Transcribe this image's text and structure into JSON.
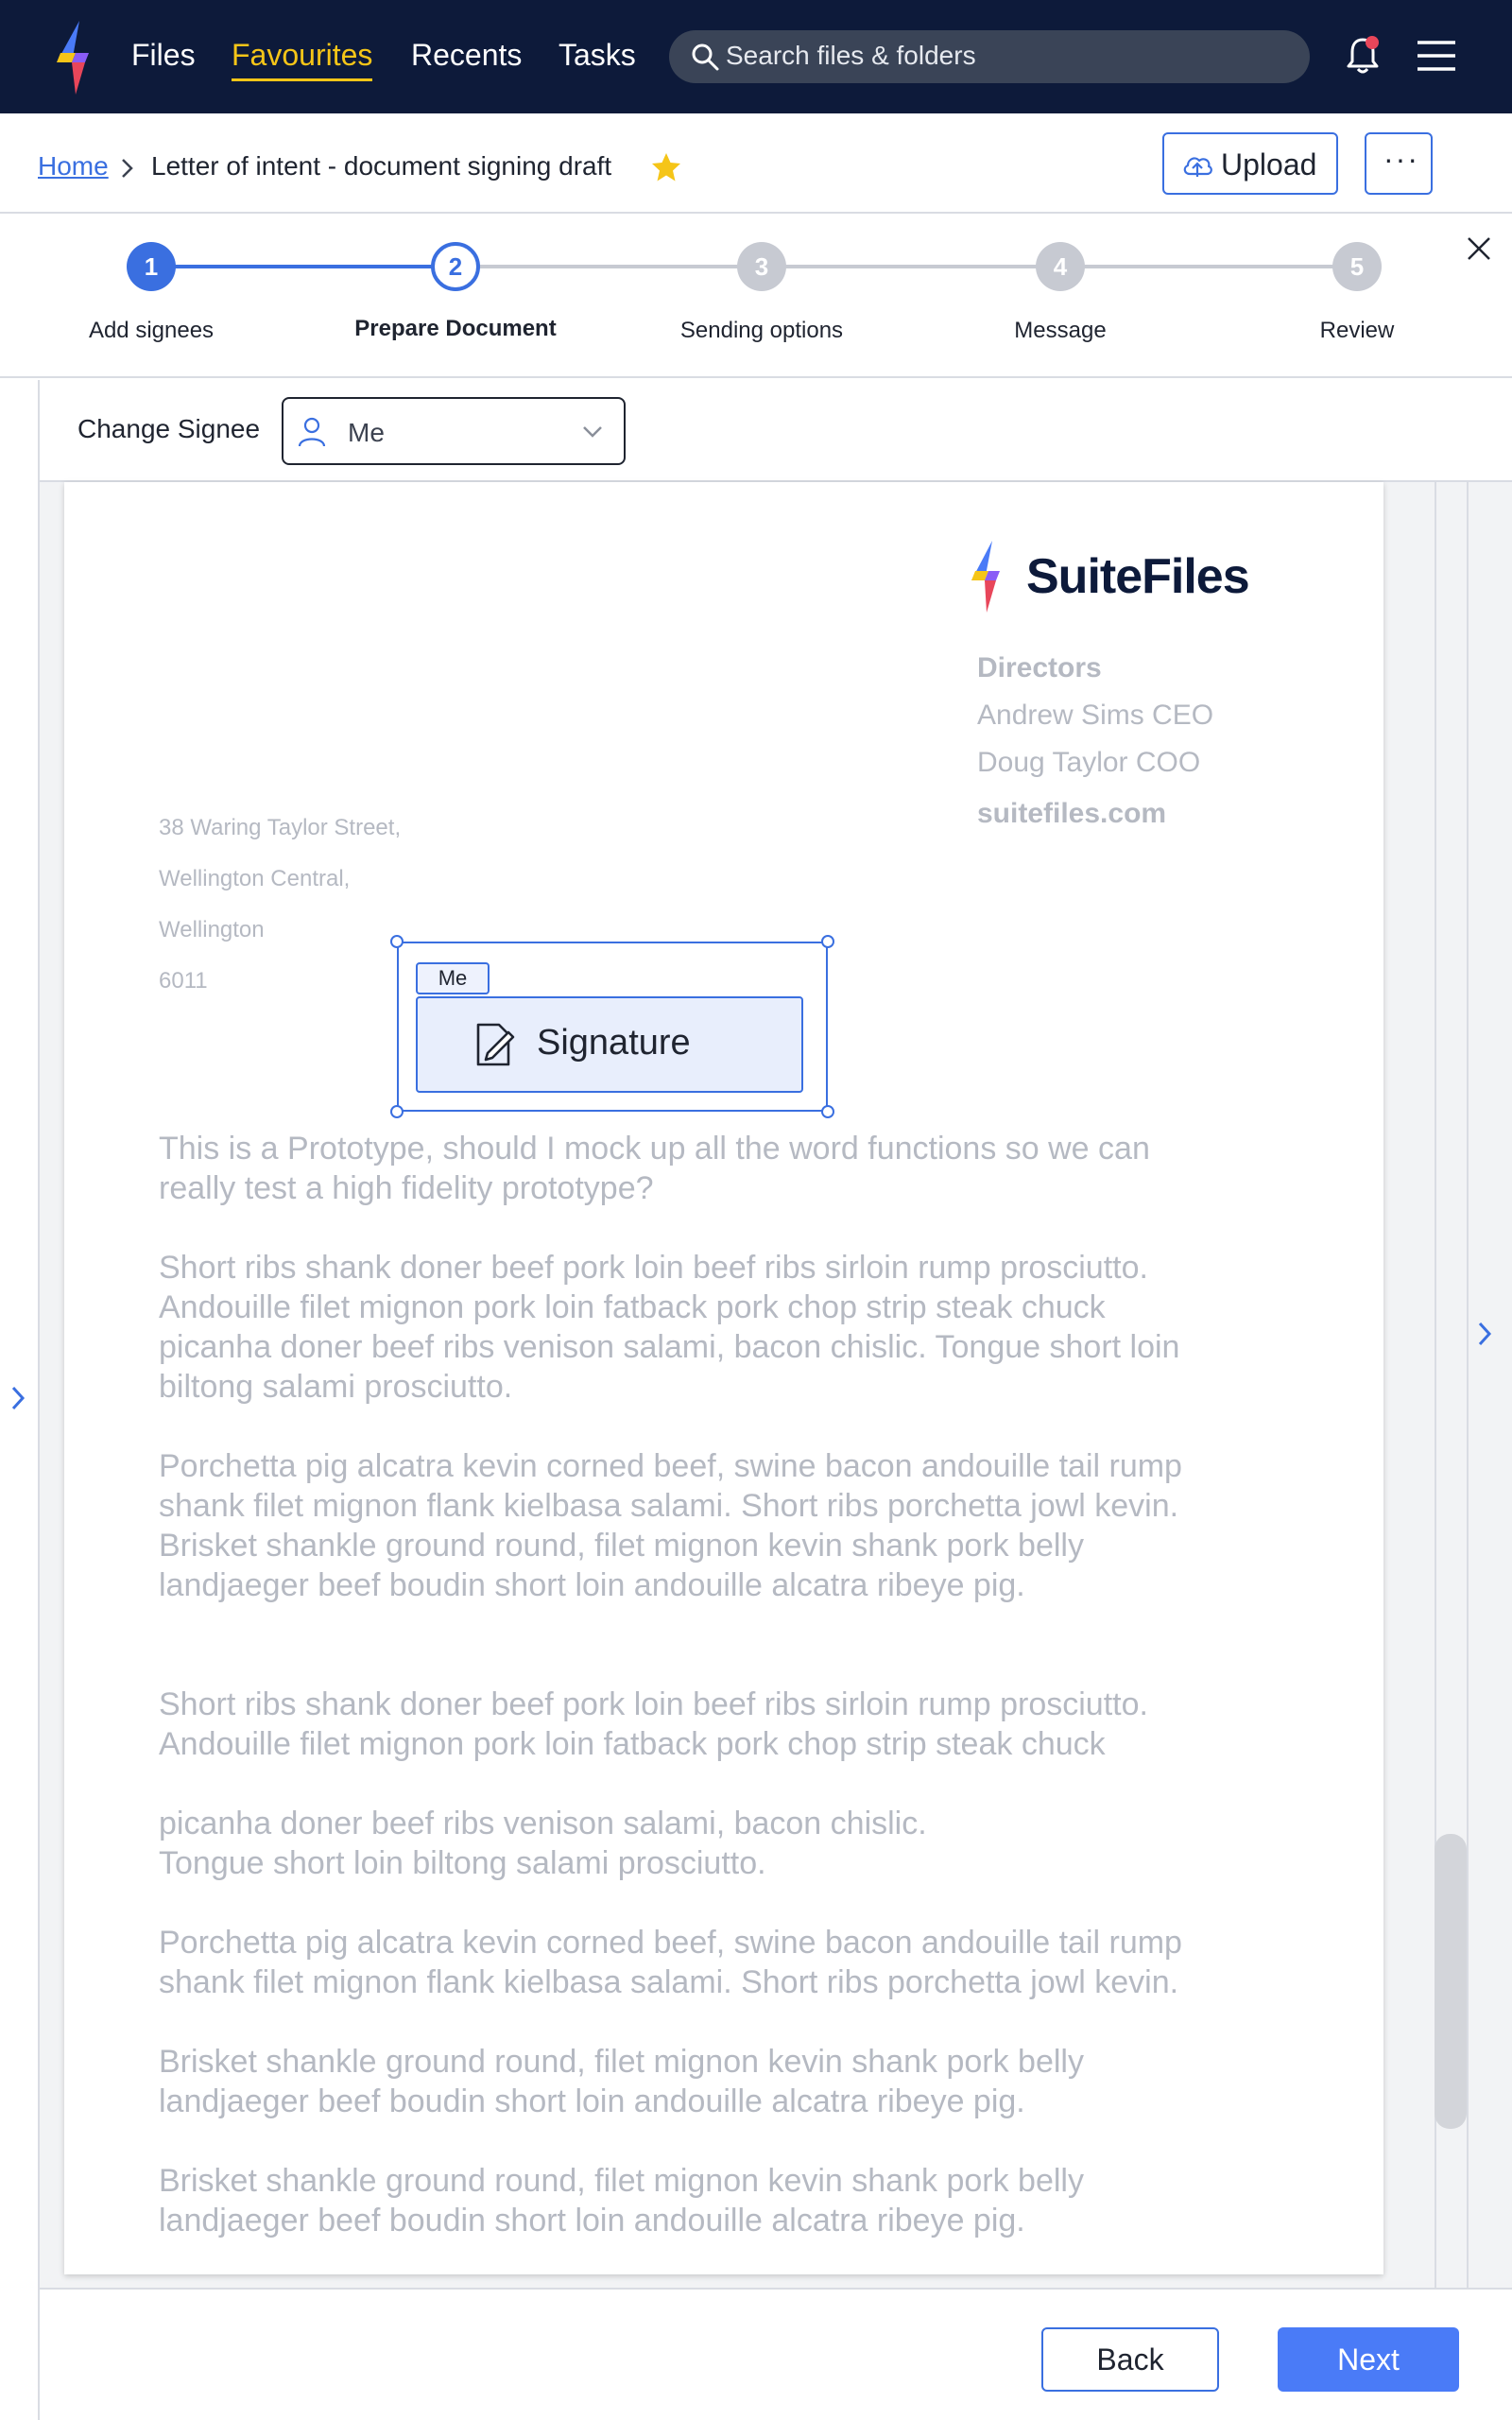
{
  "nav": {
    "items": [
      {
        "label": "Files"
      },
      {
        "label": "Favourites",
        "active": true
      },
      {
        "label": "Recents"
      },
      {
        "label": "Tasks"
      }
    ],
    "search_placeholder": "Search files & folders",
    "notification_badge": true
  },
  "breadcrumb": {
    "home": "Home",
    "title": "Letter of intent - document signing draft",
    "favourited": true
  },
  "toolbar": {
    "upload_label": "Upload",
    "more_label": "···"
  },
  "stepper": {
    "steps": [
      {
        "number": "1",
        "label": "Add signees",
        "state": "complete"
      },
      {
        "number": "2",
        "label": "Prepare Document",
        "state": "current"
      },
      {
        "number": "3",
        "label": "Sending options",
        "state": "pending"
      },
      {
        "number": "4",
        "label": "Message",
        "state": "pending"
      },
      {
        "number": "5",
        "label": "Review",
        "state": "pending"
      }
    ]
  },
  "signee": {
    "label": "Change Signee",
    "value": "Me"
  },
  "document": {
    "brand": "SuiteFiles",
    "directors_heading": "Directors",
    "directors": [
      "Andrew Sims CEO",
      "Doug Taylor COO"
    ],
    "website": "suitefiles.com",
    "address": [
      "38 Waring Taylor Street,",
      "Wellington Central,",
      "Wellington",
      "6011"
    ],
    "paragraphs": [
      [
        "This is a Prototype, should I mock up all the word functions so we can",
        "really test a high fidelity prototype?"
      ],
      [
        "Short ribs shank doner beef pork loin beef ribs sirloin rump prosciutto.",
        "Andouille filet mignon pork loin fatback pork chop strip steak chuck",
        "picanha doner beef ribs venison salami, bacon chislic. Tongue short loin",
        "biltong salami prosciutto."
      ],
      [
        "Porchetta pig alcatra kevin corned beef, swine bacon andouille tail rump",
        "shank filet mignon flank kielbasa salami. Short ribs porchetta jowl kevin.",
        "Brisket shankle ground round, filet mignon kevin shank pork belly",
        "landjaeger beef boudin short loin andouille alcatra ribeye pig."
      ],
      [
        "Short ribs shank doner beef pork loin beef ribs sirloin rump prosciutto.",
        "Andouille filet mignon pork loin fatback pork chop strip steak chuck"
      ],
      [
        "picanha doner beef ribs venison salami, bacon chislic.",
        "Tongue short loin biltong salami prosciutto."
      ],
      [
        "Porchetta pig alcatra kevin corned beef, swine bacon andouille tail rump",
        "shank filet mignon flank kielbasa salami. Short ribs porchetta jowl kevin."
      ],
      [
        "Brisket shankle ground round, filet mignon kevin shank pork belly",
        "landjaeger beef boudin short loin andouille alcatra ribeye pig."
      ],
      [
        "Brisket shankle ground round, filet mignon kevin shank pork belly",
        "landjaeger beef boudin short loin andouille alcatra ribeye pig."
      ]
    ],
    "signature_field": {
      "assignee": "Me",
      "label": "Signature"
    }
  },
  "footer": {
    "back_label": "Back",
    "next_label": "Next"
  },
  "colors": {
    "navbar": "#0d1a3a",
    "accent": "#3a6fe0",
    "active_nav": "#f5c518",
    "primary_button": "#4a7bf7",
    "muted_text": "#b5b9c2"
  }
}
